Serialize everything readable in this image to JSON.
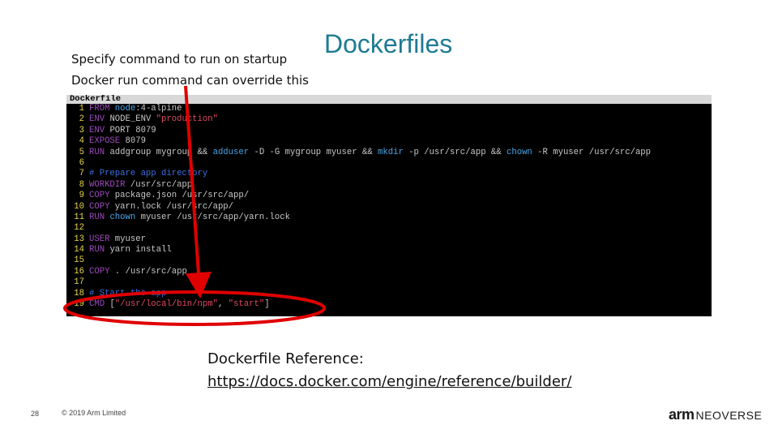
{
  "slide": {
    "title": "Dockerfiles",
    "note_line1": "Specify command to run on startup",
    "note_line2": "Docker run command can override this",
    "reference_label": "Dockerfile Reference:",
    "reference_url": "https://docs.docker.com/engine/reference/builder/",
    "page_number": "28",
    "copyright": "© 2019 Arm Limited",
    "logo_brand": "arm",
    "logo_product": "NEOVERSE",
    "annotation_color": "#e00000",
    "title_color": "#1e7b93"
  },
  "terminal": {
    "tab_label": "Dockerfile",
    "lines": [
      {
        "n": "1",
        "segs": [
          {
            "t": "FROM ",
            "c": "kw"
          },
          {
            "t": "node",
            "c": "cmd"
          },
          {
            "t": ":4-alpine",
            "c": "tx"
          }
        ]
      },
      {
        "n": "2",
        "segs": [
          {
            "t": "ENV ",
            "c": "kw"
          },
          {
            "t": "NODE_ENV ",
            "c": "tx"
          },
          {
            "t": "\"production\"",
            "c": "str"
          }
        ]
      },
      {
        "n": "3",
        "segs": [
          {
            "t": "ENV ",
            "c": "kw"
          },
          {
            "t": "PORT 8079",
            "c": "tx"
          }
        ]
      },
      {
        "n": "4",
        "segs": [
          {
            "t": "EXPOSE ",
            "c": "kw"
          },
          {
            "t": "8079",
            "c": "tx"
          }
        ]
      },
      {
        "n": "5",
        "segs": [
          {
            "t": "RUN ",
            "c": "kw"
          },
          {
            "t": "addgroup mygroup && ",
            "c": "tx"
          },
          {
            "t": "adduser",
            "c": "cmd"
          },
          {
            "t": " -D -G mygroup myuser && ",
            "c": "tx"
          },
          {
            "t": "mkdir",
            "c": "cmd"
          },
          {
            "t": " -p /usr/src/app && ",
            "c": "tx"
          },
          {
            "t": "chown",
            "c": "cmd"
          },
          {
            "t": " -R myuser /usr/src/app",
            "c": "tx"
          }
        ]
      },
      {
        "n": "6",
        "segs": []
      },
      {
        "n": "7",
        "segs": [
          {
            "t": "# Prepare app directory",
            "c": "cmt"
          }
        ]
      },
      {
        "n": "8",
        "segs": [
          {
            "t": "WORKDIR ",
            "c": "kw"
          },
          {
            "t": "/usr/src/app",
            "c": "tx"
          }
        ]
      },
      {
        "n": "9",
        "segs": [
          {
            "t": "COPY ",
            "c": "kw"
          },
          {
            "t": "package.json /usr/src/app/",
            "c": "tx"
          }
        ]
      },
      {
        "n": "10",
        "segs": [
          {
            "t": "COPY ",
            "c": "kw"
          },
          {
            "t": "yarn.lock /usr/src/app/",
            "c": "tx"
          }
        ]
      },
      {
        "n": "11",
        "segs": [
          {
            "t": "RUN ",
            "c": "kw"
          },
          {
            "t": "chown",
            "c": "cmd"
          },
          {
            "t": " myuser /usr/src/app/yarn.lock",
            "c": "tx"
          }
        ]
      },
      {
        "n": "12",
        "segs": []
      },
      {
        "n": "13",
        "segs": [
          {
            "t": "USER ",
            "c": "kw"
          },
          {
            "t": "myuser",
            "c": "tx"
          }
        ]
      },
      {
        "n": "14",
        "segs": [
          {
            "t": "RUN ",
            "c": "kw"
          },
          {
            "t": "yarn install",
            "c": "tx"
          }
        ]
      },
      {
        "n": "15",
        "segs": []
      },
      {
        "n": "16",
        "segs": [
          {
            "t": "COPY ",
            "c": "kw"
          },
          {
            "t": ". /usr/src/app",
            "c": "tx"
          }
        ]
      },
      {
        "n": "17",
        "segs": []
      },
      {
        "n": "18",
        "segs": [
          {
            "t": "# Start the app",
            "c": "cmt"
          }
        ]
      },
      {
        "n": "19",
        "segs": [
          {
            "t": "CMD ",
            "c": "kw"
          },
          {
            "t": "[",
            "c": "tx"
          },
          {
            "t": "\"/usr/local/bin/npm\"",
            "c": "str"
          },
          {
            "t": ", ",
            "c": "tx"
          },
          {
            "t": "\"start\"",
            "c": "str"
          },
          {
            "t": "]",
            "c": "tx"
          }
        ]
      }
    ]
  }
}
